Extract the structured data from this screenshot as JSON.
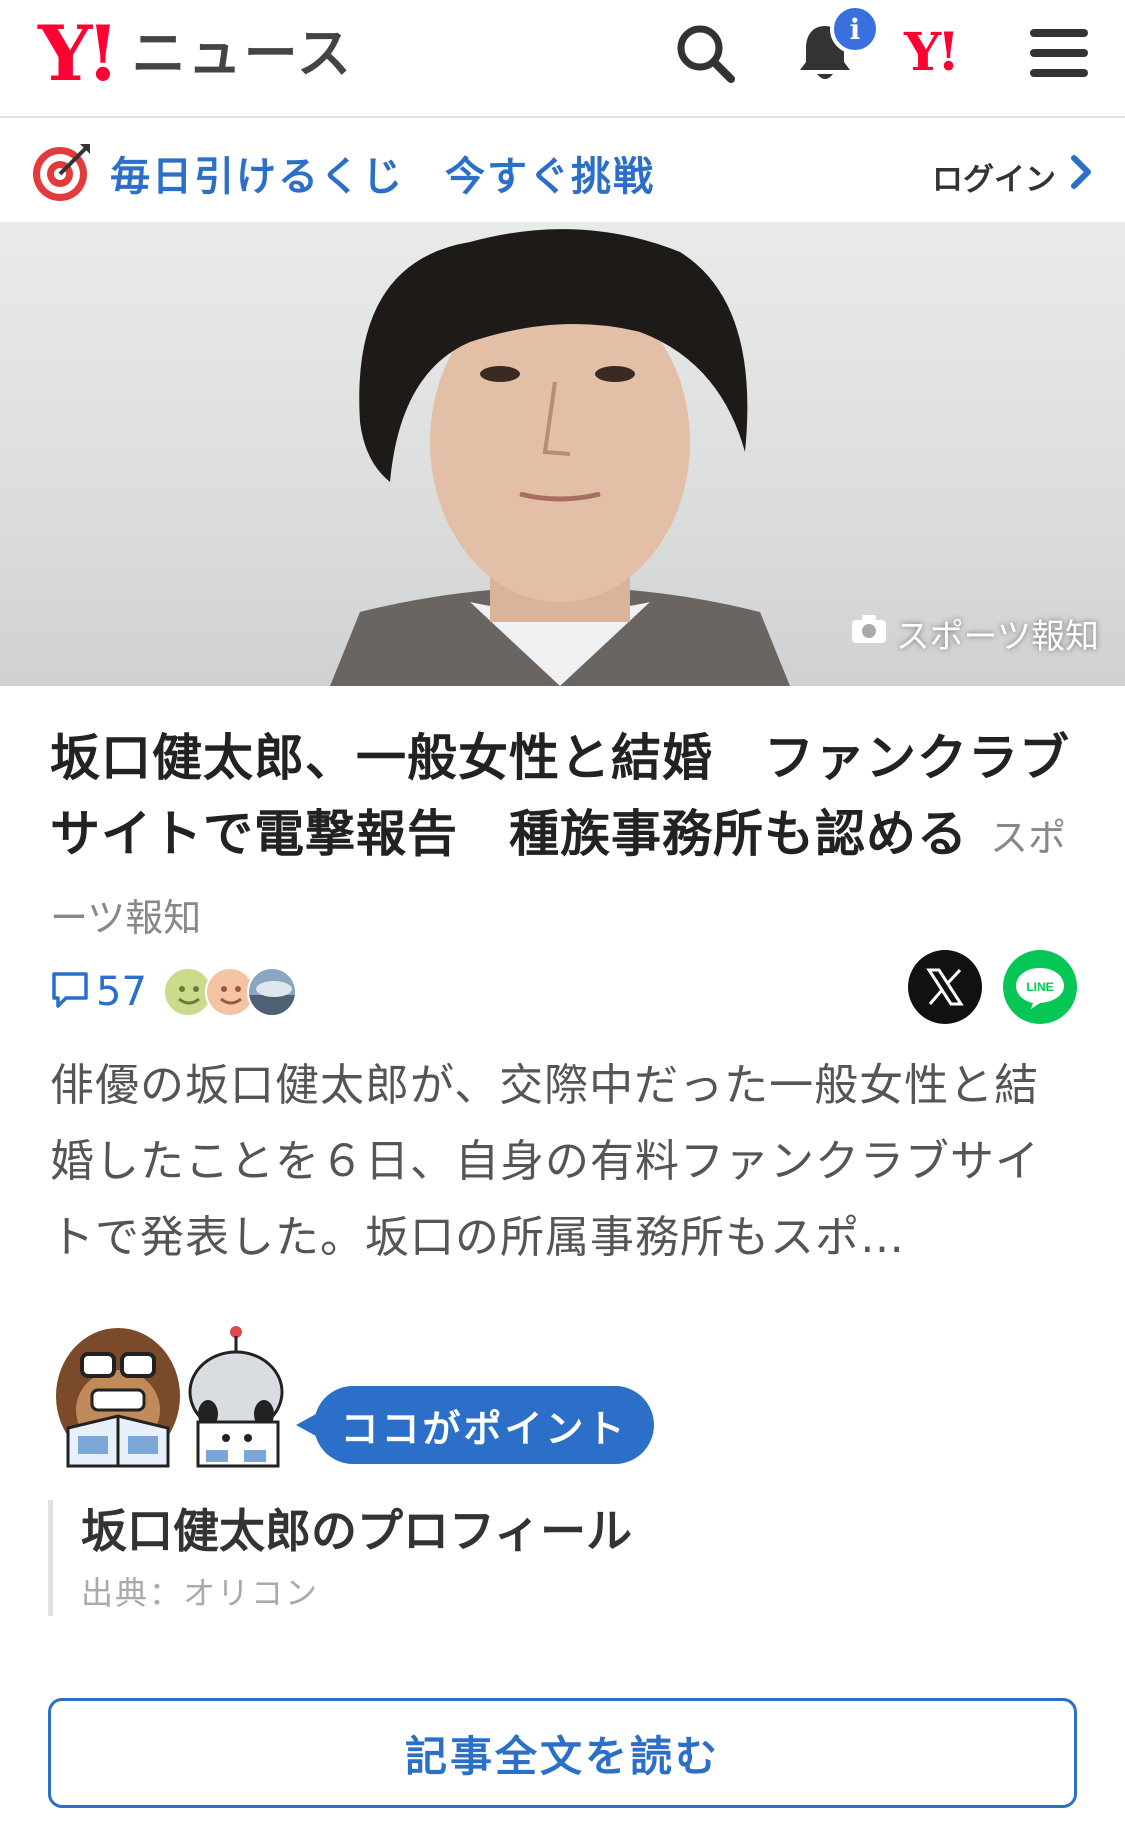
{
  "header": {
    "logo_mark": "Y!",
    "logo_text": "ニュース",
    "notification_badge": "i",
    "yahoo_mark": "Y!"
  },
  "lottery": {
    "text": "毎日引けるくじ",
    "cta": "今すぐ挑戦",
    "login": "ログイン"
  },
  "hero": {
    "credit": "スポーツ報知"
  },
  "article": {
    "headline": "坂口健太郎、一般女性と結婚　ファンクラブサイトで電撃報告　種族事務所も認める",
    "source": "スポーツ報知",
    "comment_count": "57",
    "summary": "俳優の坂口健太郎が、交際中だった一般女性と結婚したことを６日、自身の有料ファンクラブサイトで発表した。坂口の所属事務所もスポ…"
  },
  "share": {
    "x_label": "X",
    "line_label": "LINE"
  },
  "point": {
    "label": "ココがポイント",
    "profile_title": "坂口健太郎のプロフィール",
    "profile_source": "出典：オリコン"
  },
  "read_more": "記事全文を読む",
  "colors": {
    "brand_red": "#ff0033",
    "accent_blue": "#2b6fc8",
    "badge_blue": "#3a6fe0",
    "line_green": "#06c755"
  }
}
